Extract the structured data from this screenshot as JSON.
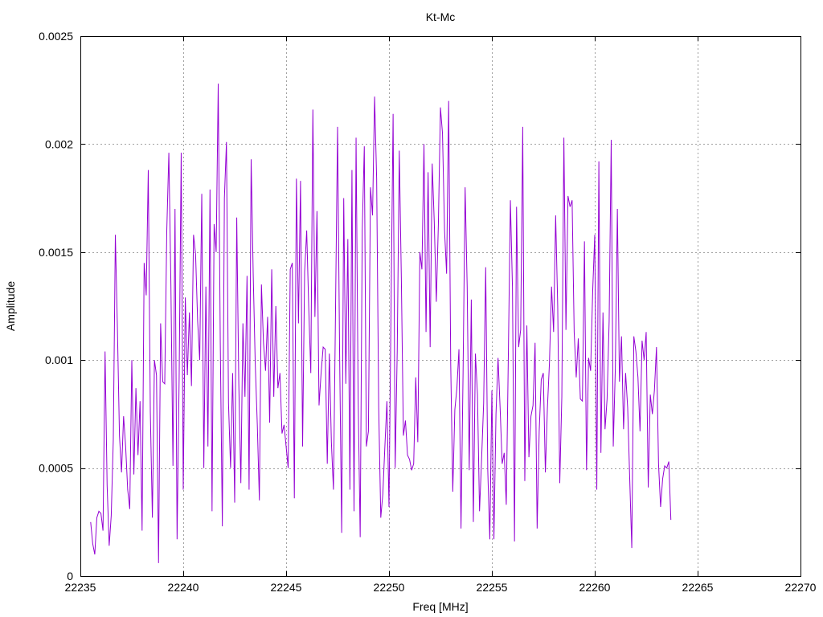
{
  "chart_data": {
    "type": "line",
    "title": "Kt-Mc",
    "xlabel": "Freq [MHz]",
    "ylabel": "Amplitude",
    "xlim": [
      22235,
      22270
    ],
    "ylim": [
      0,
      0.0025
    ],
    "x_ticks": [
      "22235",
      "22240",
      "22245",
      "22250",
      "22255",
      "22260",
      "22265",
      "22270"
    ],
    "y_ticks": [
      "0",
      "0.0005",
      "0.001",
      "0.0015",
      "0.002",
      "0.0025"
    ],
    "x_tick_values": [
      22235,
      22240,
      22245,
      22250,
      22255,
      22260,
      22265,
      22270
    ],
    "y_tick_values": [
      0,
      0.0005,
      0.001,
      0.0015,
      0.002,
      0.0025
    ],
    "grid": true,
    "series": [
      {
        "color": "#9400d3",
        "x_start": 22235.5,
        "x_step": 0.1,
        "values": [
          0.00025,
          0.00015,
          0.0001,
          0.00027,
          0.0003,
          0.00029,
          0.00021,
          0.00104,
          0.00042,
          0.00014,
          0.00028,
          0.00063,
          0.00158,
          0.00115,
          0.00065,
          0.00048,
          0.00074,
          0.0006,
          0.0004,
          0.00031,
          0.001,
          0.00047,
          0.00087,
          0.00056,
          0.00081,
          0.00021,
          0.00145,
          0.0013,
          0.00188,
          0.00076,
          0.00027,
          0.001,
          0.00093,
          6e-05,
          0.00117,
          0.0009,
          0.00089,
          0.0016,
          0.00196,
          0.00135,
          0.00051,
          0.0017,
          0.00017,
          0.00091,
          0.00196,
          0.0004,
          0.00129,
          0.00093,
          0.00122,
          0.00088,
          0.00158,
          0.00149,
          0.00118,
          0.001,
          0.00177,
          0.0005,
          0.00134,
          0.0006,
          0.00179,
          0.0003,
          0.00163,
          0.0015,
          0.00228,
          0.00108,
          0.00023,
          0.00175,
          0.00201,
          0.0008,
          0.0005,
          0.00094,
          0.00034,
          0.00166,
          0.00089,
          0.00043,
          0.00117,
          0.00083,
          0.00139,
          0.0004,
          0.00193,
          0.0014,
          0.00098,
          0.0007,
          0.00035,
          0.00135,
          0.00108,
          0.00095,
          0.0012,
          0.00071,
          0.00142,
          0.00083,
          0.00125,
          0.00087,
          0.00094,
          0.00066,
          0.0007,
          0.0006,
          0.0005,
          0.00142,
          0.00145,
          0.00036,
          0.00184,
          0.00117,
          0.00183,
          0.0006,
          0.00141,
          0.0016,
          0.00124,
          0.00094,
          0.00216,
          0.0012,
          0.00169,
          0.00079,
          0.00094,
          0.00106,
          0.00105,
          0.00052,
          0.00103,
          0.00062,
          0.0004,
          0.00122,
          0.00208,
          0.00103,
          0.0002,
          0.00175,
          0.00089,
          0.00156,
          0.0004,
          0.00188,
          0.0003,
          0.00203,
          0.00083,
          0.00018,
          0.0016,
          0.00199,
          0.0006,
          0.00067,
          0.0018,
          0.00167,
          0.00222,
          0.00184,
          0.00078,
          0.00027,
          0.00038,
          0.0006,
          0.00081,
          0.00032,
          0.00125,
          0.00214,
          0.0005,
          0.00104,
          0.00197,
          0.00138,
          0.00065,
          0.00072,
          0.00056,
          0.00054,
          0.00049,
          0.00052,
          0.00092,
          0.00062,
          0.0015,
          0.00142,
          0.002,
          0.00113,
          0.00187,
          0.00106,
          0.00191,
          0.00164,
          0.00127,
          0.00163,
          0.00217,
          0.00205,
          0.0016,
          0.0014,
          0.0022,
          0.00098,
          0.00039,
          0.00077,
          0.00087,
          0.00105,
          0.00022,
          0.00094,
          0.0018,
          0.00134,
          0.00049,
          0.00128,
          0.00025,
          0.00103,
          0.00084,
          0.0003,
          0.00054,
          0.0008,
          0.00143,
          0.00049,
          0.00017,
          0.00086,
          0.00017,
          0.00075,
          0.00101,
          0.00078,
          0.00052,
          0.00057,
          0.00033,
          0.00102,
          0.00174,
          0.00134,
          0.00016,
          0.00171,
          0.00106,
          0.00114,
          0.00208,
          0.00044,
          0.00116,
          0.00055,
          0.00074,
          0.00079,
          0.00108,
          0.00022,
          0.00067,
          0.00091,
          0.00094,
          0.00048,
          0.00078,
          0.00099,
          0.00134,
          0.00113,
          0.00167,
          0.00125,
          0.00043,
          0.00083,
          0.00203,
          0.00114,
          0.00176,
          0.00171,
          0.00174,
          0.00113,
          0.00092,
          0.0011,
          0.00082,
          0.00081,
          0.00155,
          0.00049,
          0.00101,
          0.00095,
          0.00132,
          0.00158,
          0.0004,
          0.00192,
          0.00057,
          0.00122,
          0.00068,
          0.00082,
          0.00118,
          0.00202,
          0.0006,
          0.00096,
          0.0017,
          0.0009,
          0.00111,
          0.00068,
          0.00094,
          0.00078,
          0.00045,
          0.00013,
          0.00111,
          0.00104,
          0.00092,
          0.00067,
          0.00109,
          0.001,
          0.00113,
          0.00041,
          0.00084,
          0.00075,
          0.00086,
          0.00106,
          0.00052,
          0.00032,
          0.00045,
          0.00051,
          0.0005,
          0.00053,
          0.00026
        ]
      }
    ]
  }
}
